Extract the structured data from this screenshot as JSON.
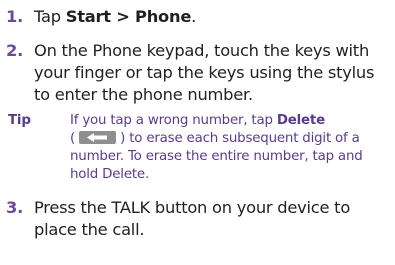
{
  "steps": [
    {
      "number": "1.",
      "parts": {
        "a": "Tap ",
        "b": "Start > Phone",
        "c": "."
      }
    },
    {
      "number": "2.",
      "text": "On the Phone keypad, touch the keys with your finger or tap the keys using the stylus to enter the phone number."
    },
    {
      "number": "3.",
      "text": "Press the TALK button on your device to place the call."
    }
  ],
  "tip": {
    "label": "Tip",
    "a": "If you tap a wrong number, tap ",
    "b": "Delete",
    "c": "(",
    "d": ") to erase each subsequent digit of a number. To erase the entire number, tap and hold Delete.",
    "icon": "backspace-icon"
  },
  "colors": {
    "text": "#231f20",
    "accent": "#6a4a9c",
    "tip": "#5a3c8e",
    "key": "#8f8f8f"
  }
}
